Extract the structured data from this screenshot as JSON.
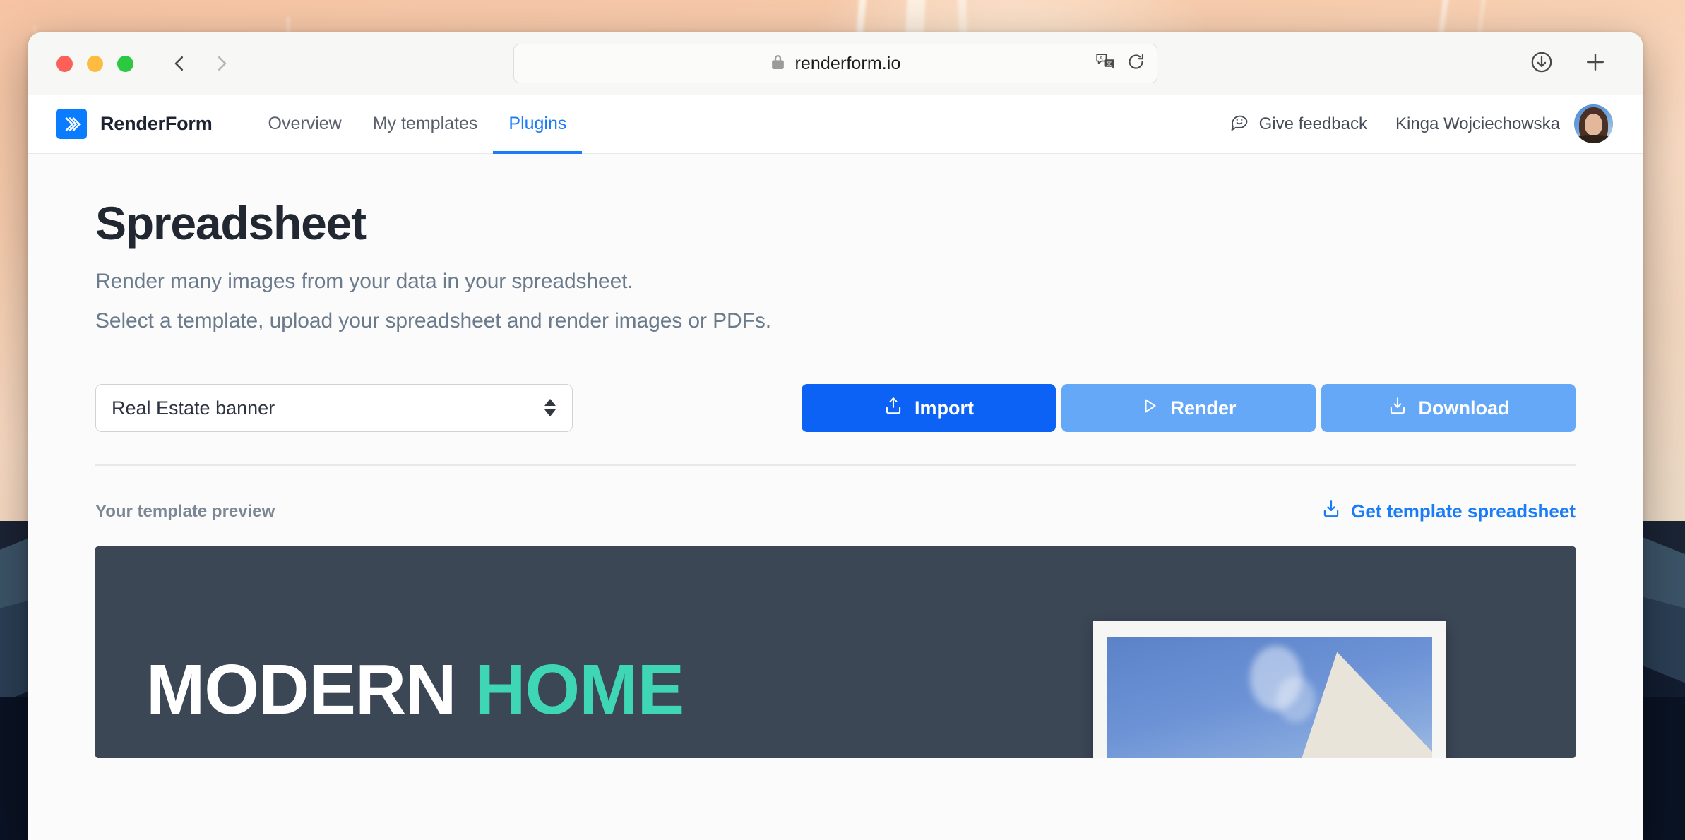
{
  "browser": {
    "url": "renderform.io",
    "lock_icon": "lock-icon",
    "translate_icon": "translate-icon",
    "reload_icon": "reload-icon",
    "back_icon": "back-arrow-icon",
    "forward_icon": "forward-arrow-icon",
    "downloads_icon": "downloads-icon",
    "new_tab_icon": "new-tab-icon",
    "traffic_lights": [
      "close",
      "minimize",
      "maximize"
    ]
  },
  "app_nav": {
    "brand": "RenderForm",
    "logo_icon": "renderform-logo-icon",
    "tabs": [
      {
        "label": "Overview",
        "active": false
      },
      {
        "label": "My templates",
        "active": false
      },
      {
        "label": "Plugins",
        "active": true
      }
    ],
    "feedback": {
      "label": "Give feedback",
      "icon": "smiley-chat-icon"
    },
    "user": {
      "name": "Kinga Wojciechowska",
      "avatar": "user-avatar"
    }
  },
  "page": {
    "title": "Spreadsheet",
    "description_line1": "Render many images from your data in your spreadsheet.",
    "description_line2": "Select a template, upload your spreadsheet and render images or PDFs."
  },
  "controls": {
    "template_select": {
      "value": "Real Estate banner",
      "options": [
        "Real Estate banner"
      ],
      "stepper_icon": "stepper-updown-icon"
    },
    "buttons": [
      {
        "label": "Import",
        "icon": "upload-icon",
        "state": "enabled",
        "color": "#0b62f4"
      },
      {
        "label": "Render",
        "icon": "play-icon",
        "state": "disabled",
        "color": "#64a8f7"
      },
      {
        "label": "Download",
        "icon": "download-icon",
        "state": "disabled",
        "color": "#64a8f7"
      }
    ]
  },
  "preview_section": {
    "label": "Your template preview",
    "get_template_link": {
      "label": "Get template spreadsheet",
      "icon": "download-icon"
    }
  },
  "template_preview": {
    "headline_part1": "MODERN ",
    "headline_part2": "HOME",
    "background_color": "#3c4756",
    "accent_color": "#3ed6b4",
    "photo_alt": "house-photo"
  }
}
